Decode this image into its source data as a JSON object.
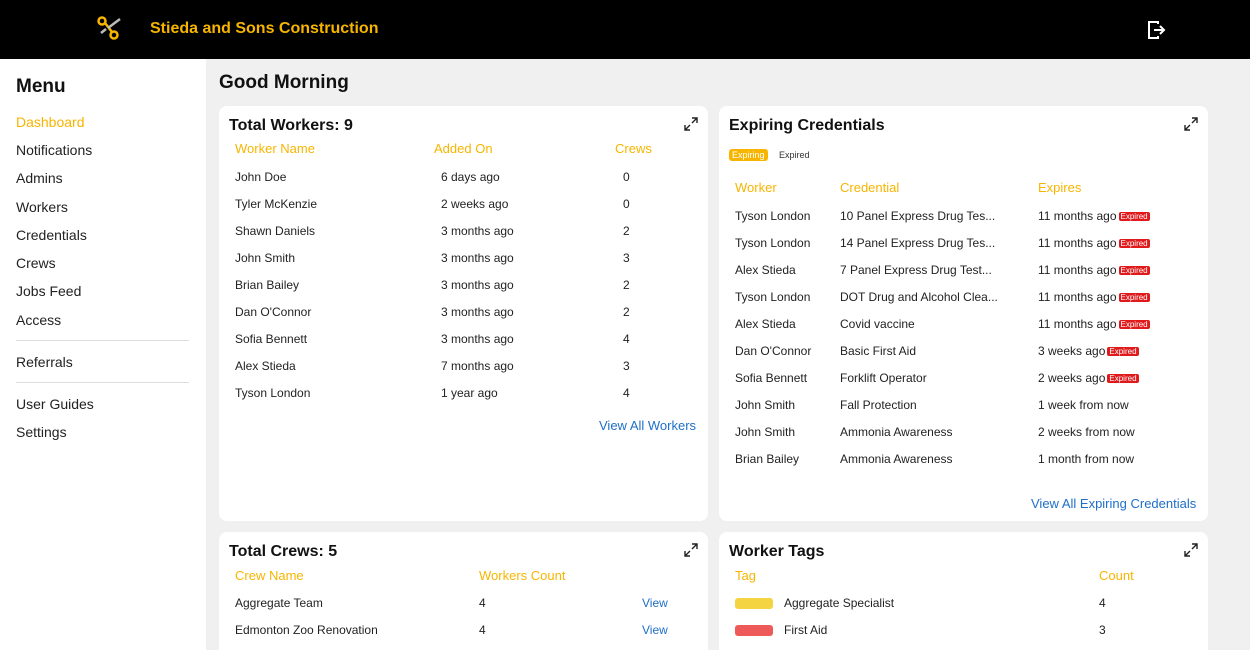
{
  "header": {
    "company": "Stieda and Sons Construction",
    "logo_icon": "scissor-lift-icon",
    "logout_icon": "logout-icon",
    "brand_color": "#f7b500"
  },
  "sidebar": {
    "title": "Menu",
    "items": [
      {
        "label": "Dashboard",
        "active": true
      },
      {
        "label": "Notifications"
      },
      {
        "label": "Admins"
      },
      {
        "label": "Workers"
      },
      {
        "label": "Credentials"
      },
      {
        "label": "Crews"
      },
      {
        "label": "Jobs Feed"
      },
      {
        "label": "Access"
      }
    ],
    "items2": [
      {
        "label": "Referrals"
      }
    ],
    "items3": [
      {
        "label": "User Guides"
      },
      {
        "label": "Settings"
      }
    ]
  },
  "main": {
    "greeting": "Good Morning",
    "workers": {
      "title": "Total Workers: 9",
      "columns": [
        "Worker Name",
        "Added On",
        "Crews"
      ],
      "rows": [
        [
          "John Doe",
          "6 days ago",
          "0"
        ],
        [
          "Tyler McKenzie",
          "2 weeks ago",
          "0"
        ],
        [
          "Shawn Daniels",
          "3 months ago",
          "2"
        ],
        [
          "John Smith",
          "3 months ago",
          "3"
        ],
        [
          "Brian Bailey",
          "3 months ago",
          "2"
        ],
        [
          "Dan O'Connor",
          "3 months ago",
          "2"
        ],
        [
          "Sofia Bennett",
          "3 months ago",
          "4"
        ],
        [
          "Alex Stieda",
          "7 months ago",
          "3"
        ],
        [
          "Tyson London",
          "1 year ago",
          "4"
        ]
      ],
      "view_all": "View All Workers"
    },
    "credentials": {
      "title": "Expiring Credentials",
      "tabs": [
        "Expiring",
        "Expired"
      ],
      "columns": [
        "Worker",
        "Credential",
        "Expires"
      ],
      "expired_label": "Expired",
      "rows": [
        [
          "Tyson London",
          "10 Panel Express Drug Tes...",
          "11 months ago",
          true
        ],
        [
          "Tyson London",
          "14 Panel Express Drug Tes...",
          "11 months ago",
          true
        ],
        [
          "Alex Stieda",
          "7 Panel Express Drug Test...",
          "11 months ago",
          true
        ],
        [
          "Tyson London",
          "DOT Drug and Alcohol Clea...",
          "11 months ago",
          true
        ],
        [
          "Alex Stieda",
          "Covid vaccine",
          "11 months ago",
          true
        ],
        [
          "Dan O'Connor",
          "Basic First Aid",
          "3 weeks ago",
          true
        ],
        [
          "Sofia Bennett",
          "Forklift Operator",
          "2 weeks ago",
          true
        ],
        [
          "John Smith",
          "Fall Protection",
          "1 week from now",
          false
        ],
        [
          "John Smith",
          "Ammonia Awareness",
          "2 weeks from now",
          false
        ],
        [
          "Brian Bailey",
          "Ammonia Awareness",
          "1 month from now",
          false
        ]
      ],
      "view_all": "View All Expiring Credentials"
    },
    "crews": {
      "title": "Total Crews: 5",
      "columns": [
        "Crew Name",
        "Workers Count"
      ],
      "view_label": "View",
      "rows": [
        [
          "Aggregate Team",
          "4"
        ],
        [
          "Edmonton Zoo Renovation",
          "4"
        ]
      ]
    },
    "tags": {
      "title": "Worker Tags",
      "columns": [
        "Tag",
        "Count"
      ],
      "rows": [
        {
          "name": "Aggregate Specialist",
          "count": "4",
          "color": "#f5d442"
        },
        {
          "name": "First Aid",
          "count": "3",
          "color": "#ee5a5a"
        }
      ]
    }
  }
}
